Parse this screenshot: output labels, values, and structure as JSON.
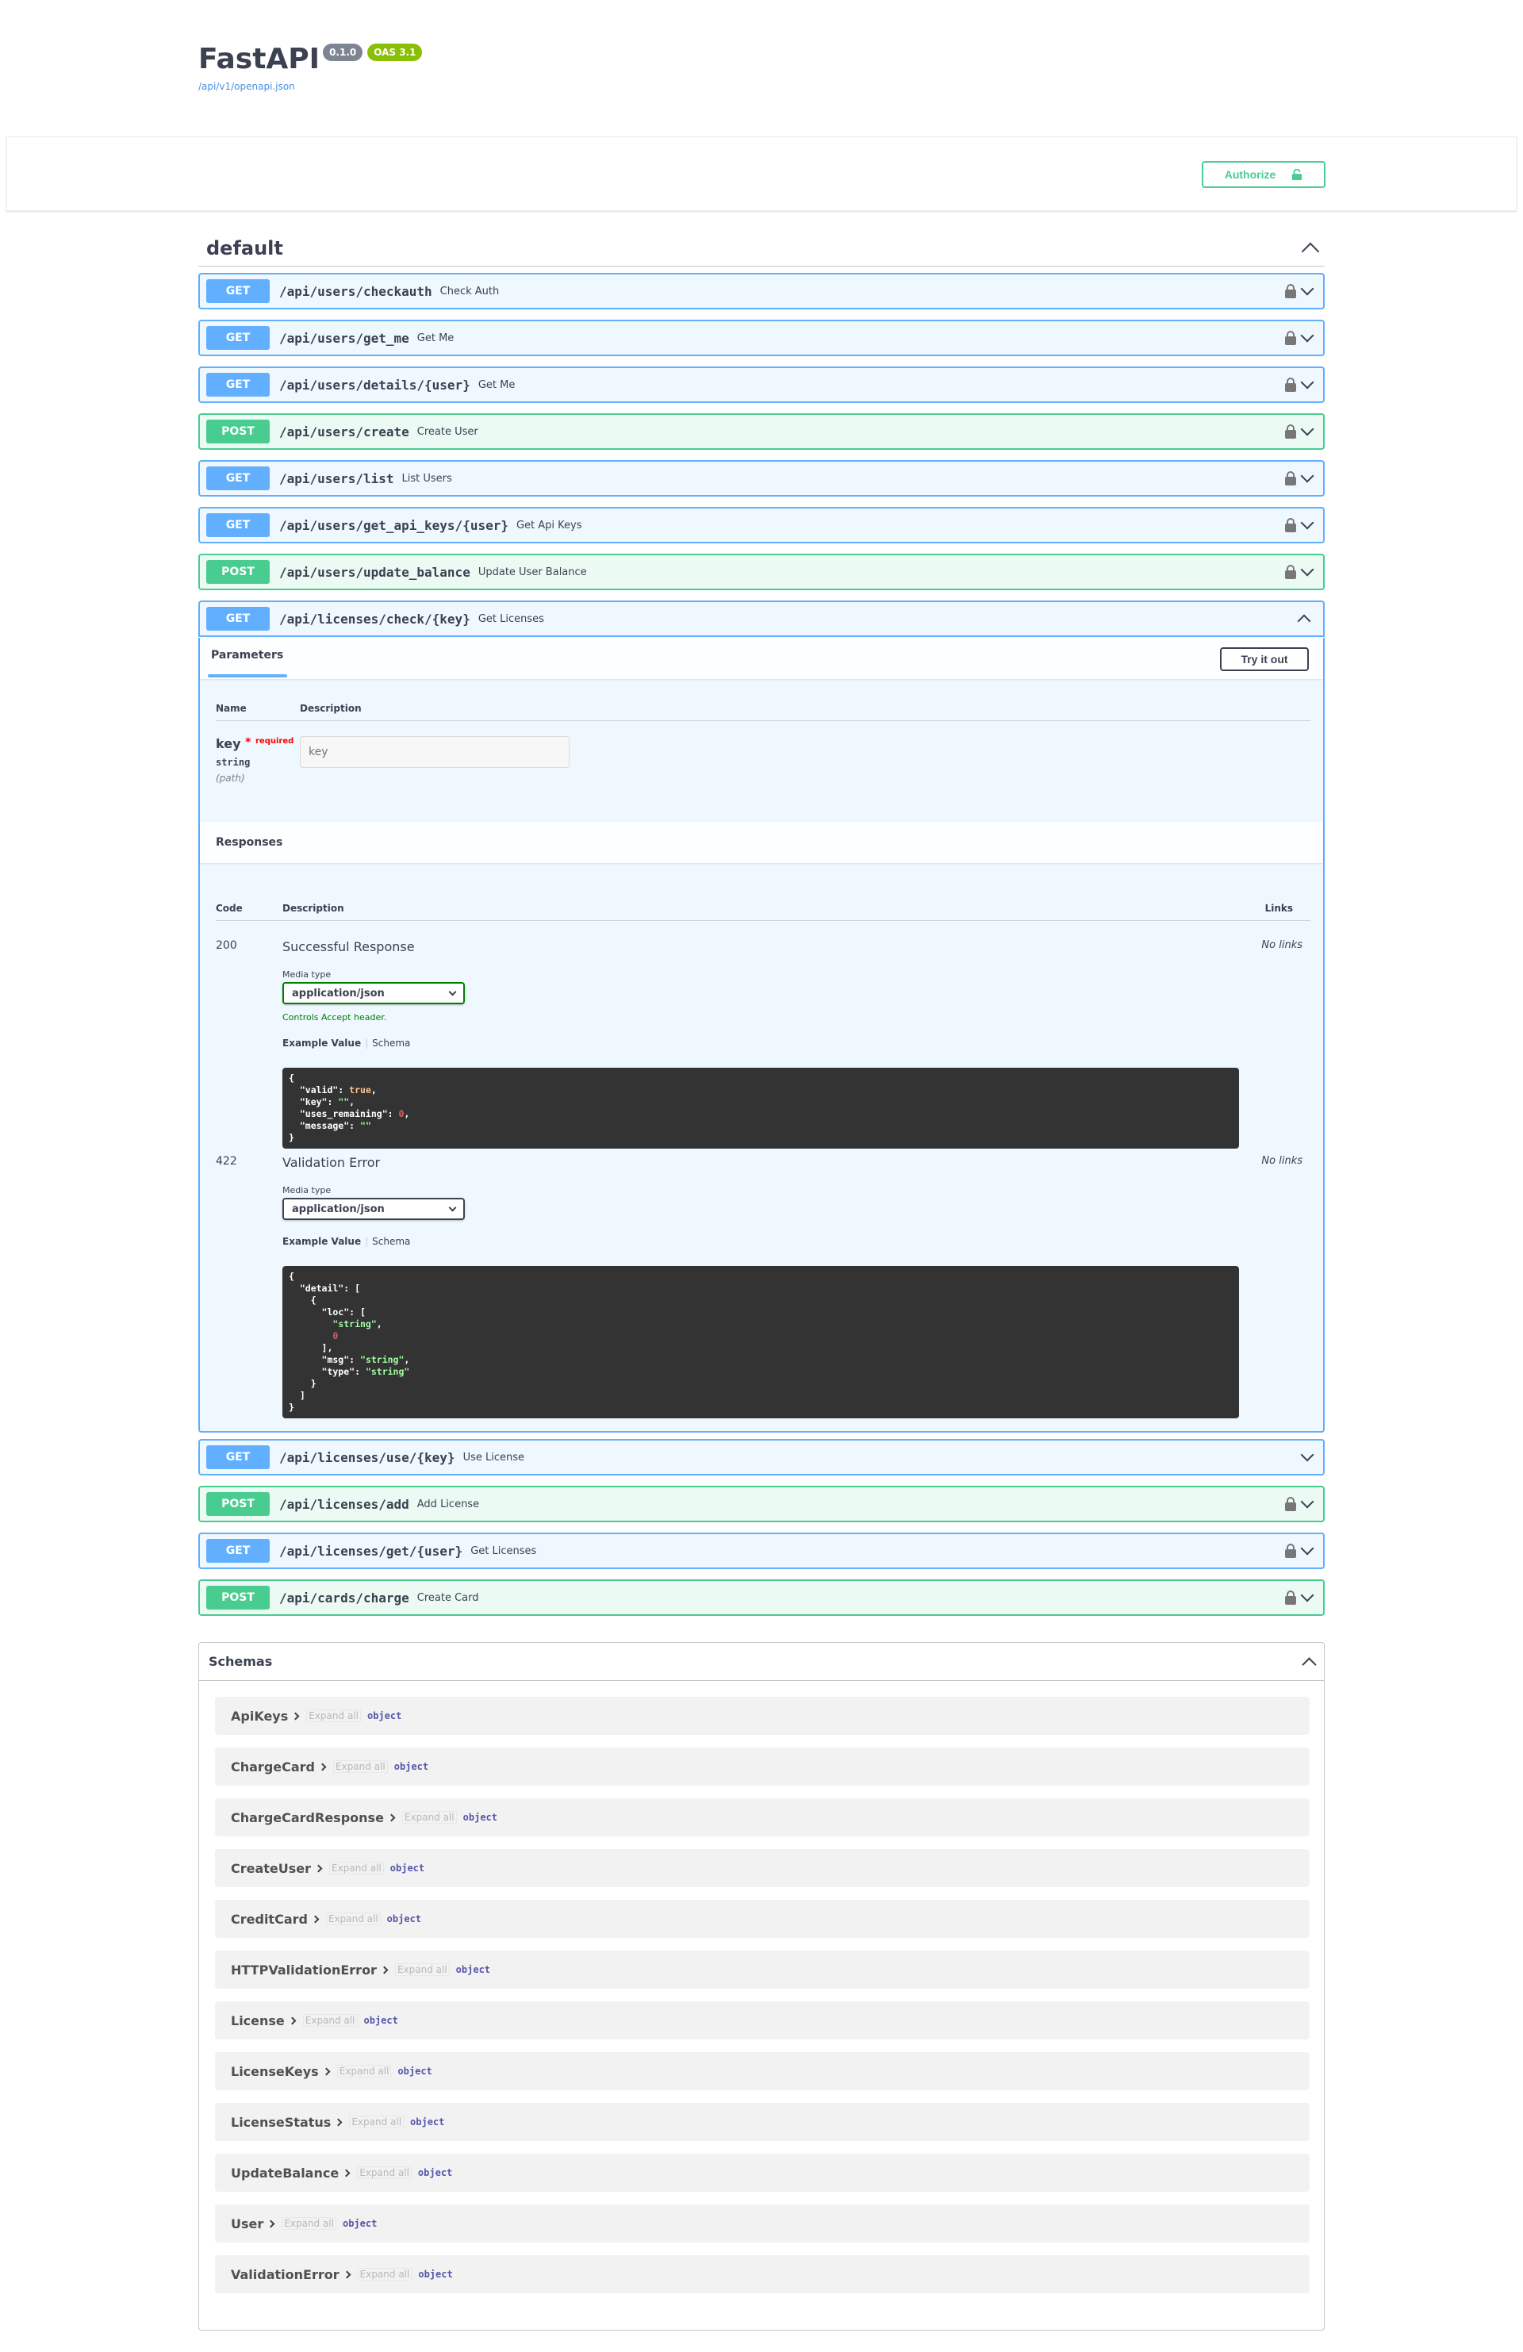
{
  "info": {
    "title": "FastAPI",
    "version_badge": "0.1.0",
    "oas_badge": "OAS 3.1",
    "spec_link": "/api/v1/openapi.json"
  },
  "auth": {
    "authorize_label": "Authorize"
  },
  "section": {
    "title": "default"
  },
  "operations": [
    {
      "method": "GET",
      "path": "/api/users/checkauth",
      "summary": "Check Auth",
      "locked": true
    },
    {
      "method": "GET",
      "path": "/api/users/get_me",
      "summary": "Get Me",
      "locked": true
    },
    {
      "method": "GET",
      "path": "/api/users/details/{user}",
      "summary": "Get Me",
      "locked": true
    },
    {
      "method": "POST",
      "path": "/api/users/create",
      "summary": "Create User",
      "locked": true
    },
    {
      "method": "GET",
      "path": "/api/users/list",
      "summary": "List Users",
      "locked": true
    },
    {
      "method": "GET",
      "path": "/api/users/get_api_keys/{user}",
      "summary": "Get Api Keys",
      "locked": true
    },
    {
      "method": "POST",
      "path": "/api/users/update_balance",
      "summary": "Update User Balance",
      "locked": true
    },
    {
      "method": "GET",
      "path": "/api/licenses/check/{key}",
      "summary": "Get Licenses",
      "locked": false,
      "expanded": true
    },
    {
      "method": "GET",
      "path": "/api/licenses/use/{key}",
      "summary": "Use License",
      "locked": false
    },
    {
      "method": "POST",
      "path": "/api/licenses/add",
      "summary": "Add License",
      "locked": true
    },
    {
      "method": "GET",
      "path": "/api/licenses/get/{user}",
      "summary": "Get Licenses",
      "locked": true
    },
    {
      "method": "POST",
      "path": "/api/cards/charge",
      "summary": "Create Card",
      "locked": true
    }
  ],
  "expanded": {
    "parameters_tab": "Parameters",
    "try_it_out": "Try it out",
    "col_name": "Name",
    "col_description": "Description",
    "param": {
      "name": "key",
      "required_star": "*",
      "required_text": "required",
      "type": "string",
      "in": "(path)",
      "placeholder": "key"
    },
    "responses_title": "Responses",
    "resp_col_code": "Code",
    "resp_col_description": "Description",
    "resp_col_links": "Links",
    "responses": [
      {
        "code": "200",
        "description": "Successful Response",
        "links": "No links",
        "media_label": "Media type",
        "media_type": "application/json",
        "controls_note": "Controls Accept header.",
        "example_value": "Example Value",
        "schema": "Schema"
      },
      {
        "code": "422",
        "description": "Validation Error",
        "links": "No links",
        "media_label": "Media type",
        "media_type": "application/json",
        "example_value": "Example Value",
        "schema": "Schema"
      }
    ]
  },
  "schemas": {
    "title": "Schemas",
    "expand_all": "Expand all",
    "items": [
      {
        "name": "ApiKeys",
        "type": "object"
      },
      {
        "name": "ChargeCard",
        "type": "object"
      },
      {
        "name": "ChargeCardResponse",
        "type": "object"
      },
      {
        "name": "CreateUser",
        "type": "object"
      },
      {
        "name": "CreditCard",
        "type": "object"
      },
      {
        "name": "HTTPValidationError",
        "type": "object"
      },
      {
        "name": "License",
        "type": "object"
      },
      {
        "name": "LicenseKeys",
        "type": "object"
      },
      {
        "name": "LicenseStatus",
        "type": "object"
      },
      {
        "name": "UpdateBalance",
        "type": "object"
      },
      {
        "name": "User",
        "type": "object"
      },
      {
        "name": "ValidationError",
        "type": "object"
      }
    ]
  },
  "colors": {
    "get": "#61affe",
    "post": "#49cc90",
    "accent_green": "#89bf04",
    "code_bg": "#333333"
  },
  "icons": {
    "lock": "lock-icon",
    "unlock": "unlock-icon",
    "chevron_down": "chevron-down-icon",
    "chevron_up": "chevron-up-icon",
    "chevron_right": "chevron-right-icon"
  }
}
